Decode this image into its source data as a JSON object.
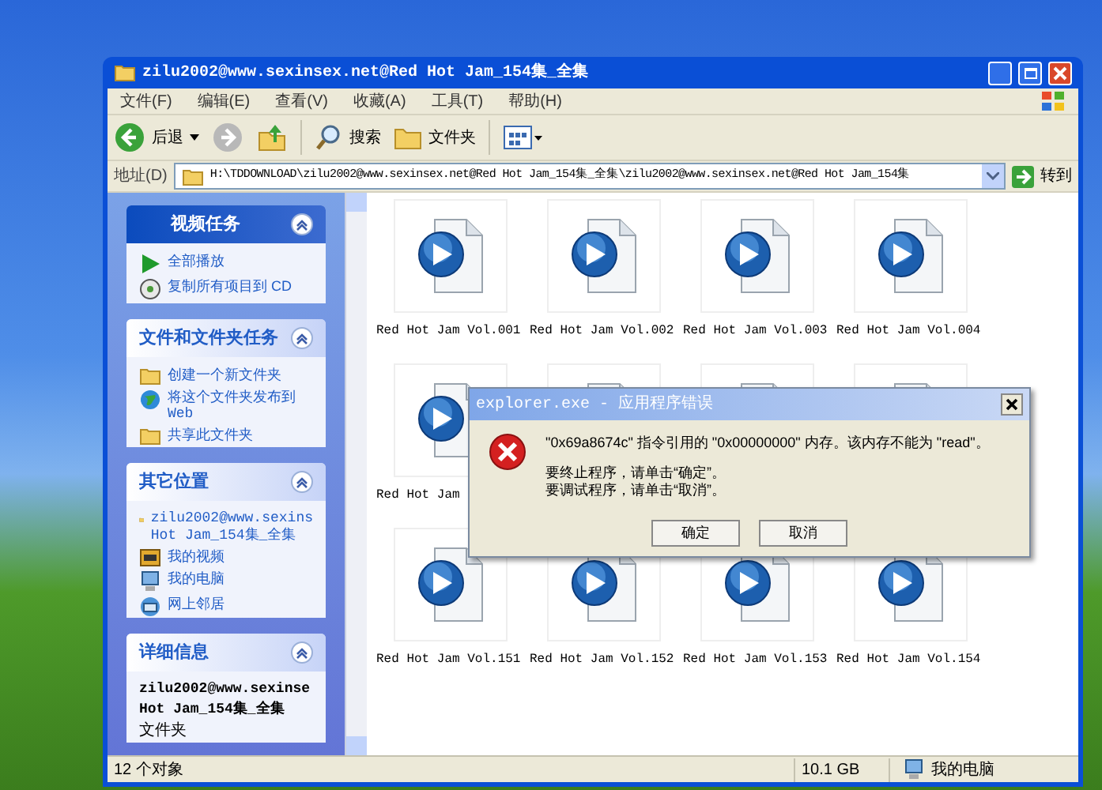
{
  "window": {
    "title": "zilu2002@www.sexinsex.net@Red Hot Jam_154集_全集"
  },
  "menu": [
    "文件(F)",
    "编辑(E)",
    "查看(V)",
    "收藏(A)",
    "工具(T)",
    "帮助(H)"
  ],
  "toolbar": {
    "back": "后退",
    "search": "搜索",
    "folders": "文件夹"
  },
  "address": {
    "label": "地址(D)",
    "value": "H:\\TDDOWNLOAD\\zilu2002@www.sexinsex.net@Red Hot Jam_154集_全集\\zilu2002@www.sexinsex.net@Red Hot Jam_154集",
    "go": "转到"
  },
  "sidebar": {
    "panels": [
      {
        "kind": "special",
        "title": "视频任务",
        "items": [
          {
            "kind": "play",
            "lines": [
              "全部播放"
            ]
          },
          {
            "kind": "disc",
            "lines": [
              "复制所有项目到 CD"
            ]
          }
        ]
      },
      {
        "kind": "plain",
        "title": "文件和文件夹任务",
        "items": [
          {
            "kind": "folder",
            "lines": [
              "创建一个新文件夹"
            ]
          },
          {
            "kind": "globe",
            "lines": [
              "将这个文件夹发布到",
              "Web"
            ]
          },
          {
            "kind": "folder",
            "lines": [
              "共享此文件夹"
            ]
          }
        ]
      },
      {
        "kind": "plain",
        "title": "其它位置",
        "items": [
          {
            "kind": "folder",
            "lines": [
              "zilu2002@www.sexins",
              "Hot Jam_154集_全集"
            ]
          },
          {
            "kind": "film",
            "lines": [
              "我的视频"
            ]
          },
          {
            "kind": "computer",
            "lines": [
              "我的电脑"
            ]
          },
          {
            "kind": "network",
            "lines": [
              "网上邻居"
            ]
          }
        ]
      },
      {
        "kind": "details",
        "title": "详细信息",
        "name_lines": [
          "zilu2002@www.sexinse",
          "Hot Jam_154集_全集"
        ],
        "type": "文件夹"
      }
    ]
  },
  "files": [
    [
      {
        "kind": "video",
        "label": "Red Hot Jam Vol.001"
      },
      {
        "kind": "video",
        "label": "Red Hot Jam Vol.002"
      },
      {
        "kind": "video",
        "label": "Red Hot Jam Vol.003"
      },
      {
        "kind": "video",
        "label": "Red Hot Jam Vol.004"
      }
    ],
    [
      {
        "kind": "video",
        "label": "Red Hot Jam"
      },
      {
        "kind": "video"
      },
      {
        "kind": "video"
      },
      {
        "kind": "video"
      }
    ],
    [
      {
        "kind": "video",
        "label": "Red Hot Jam Vol.151"
      },
      {
        "kind": "video",
        "label": "Red Hot Jam Vol.152"
      },
      {
        "kind": "video",
        "label": "Red Hot Jam Vol.153"
      },
      {
        "kind": "video",
        "label": "Red Hot Jam Vol.154"
      }
    ]
  ],
  "status_bar": {
    "count": "12 个对象",
    "size": "10.1 GB",
    "location": "我的电脑"
  },
  "dialog": {
    "title": "explorer.exe - 应用程序错误",
    "message": "\"0x69a8674c\" 指令引用的 \"0x00000000\" 内存。该内存不能为 \"read\"。",
    "lines": [
      "要终止程序，请单击“确定”。",
      "要调试程序，请单击“取消”。"
    ],
    "buttons": [
      "确定",
      "取消"
    ]
  }
}
